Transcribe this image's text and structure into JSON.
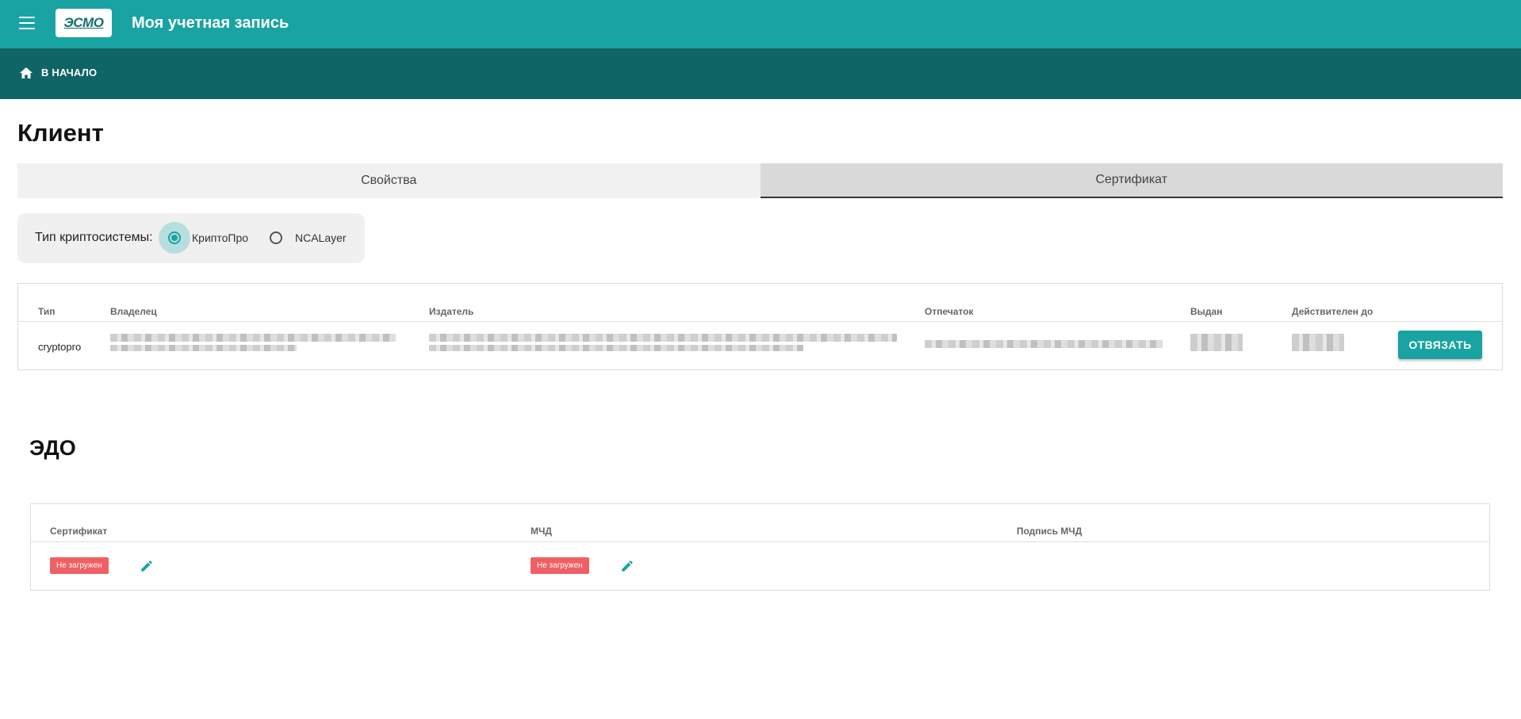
{
  "header": {
    "logo_text": "ЭСМО",
    "title": "Моя учетная запись"
  },
  "breadcrumb": {
    "home_label": "В НАЧАЛО"
  },
  "page": {
    "title": "Клиент"
  },
  "tabs": [
    {
      "label": "Свойства",
      "active": false
    },
    {
      "label": "Сертификат",
      "active": true
    }
  ],
  "crypto": {
    "label": "Тип криптосистемы:",
    "options": [
      {
        "label": "КриптоПро",
        "selected": true
      },
      {
        "label": "NCALayer",
        "selected": false
      }
    ]
  },
  "cert_table": {
    "headers": [
      "Тип",
      "Владелец",
      "Издатель",
      "Отпечаток",
      "Выдан",
      "Действителен до"
    ],
    "rows": [
      {
        "type": "cryptopro",
        "action_label": "ОТВЯЗАТЬ"
      }
    ]
  },
  "edo": {
    "title": "ЭДО",
    "headers": [
      "Сертификат",
      "МЧД",
      "Подпись МЧД"
    ],
    "certificate_status": "Не загружен",
    "mchd_status": "Не загружен"
  },
  "colors": {
    "primary": "#19a3a3",
    "primary_dark": "#0f6565",
    "badge_error": "#f06063"
  }
}
